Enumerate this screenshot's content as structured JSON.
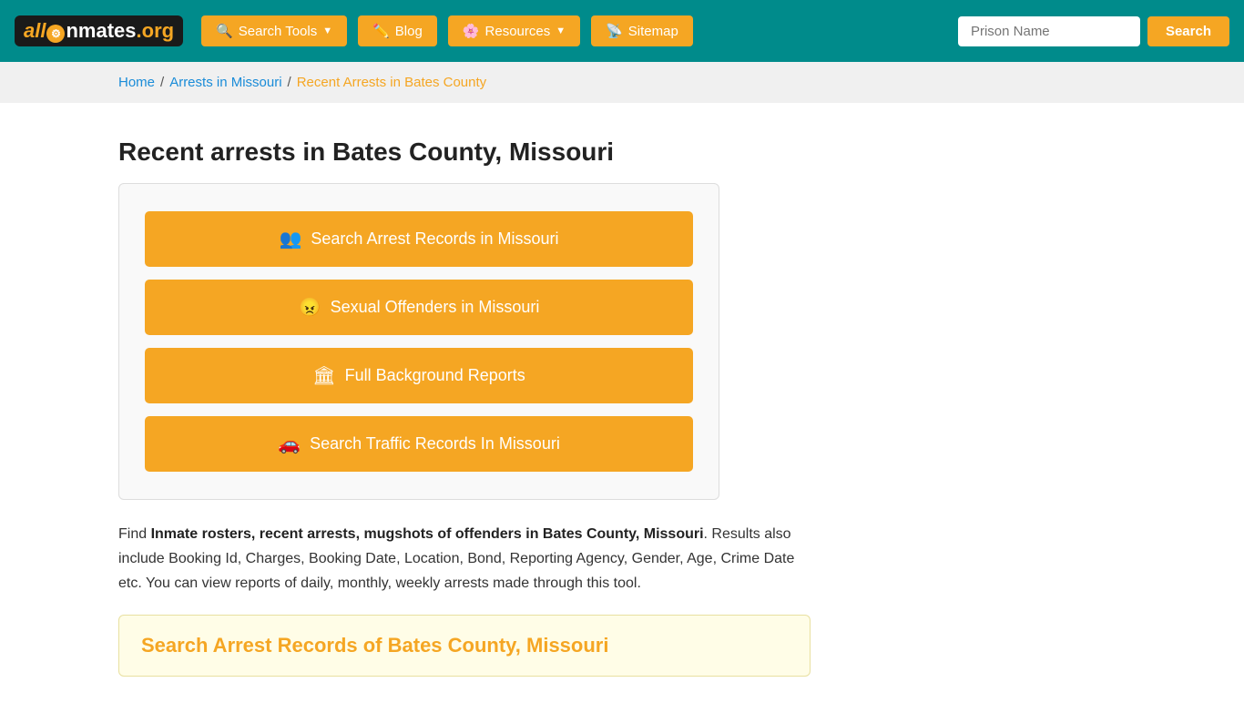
{
  "header": {
    "logo": {
      "text_all": "all",
      "text_inmates": "Inmates",
      "text_org": ".org"
    },
    "nav": [
      {
        "id": "search-tools",
        "label": "Search Tools",
        "has_dropdown": true,
        "icon": "🔍"
      },
      {
        "id": "blog",
        "label": "Blog",
        "has_dropdown": false,
        "icon": "✏️"
      },
      {
        "id": "resources",
        "label": "Resources",
        "has_dropdown": true,
        "icon": "🌸"
      },
      {
        "id": "sitemap",
        "label": "Sitemap",
        "has_dropdown": false,
        "icon": "📡"
      }
    ],
    "search_input_placeholder": "Prison Name",
    "search_button_label": "Search"
  },
  "breadcrumb": {
    "home": "Home",
    "arrests": "Arrests in Missouri",
    "current": "Recent Arrests in Bates County"
  },
  "page": {
    "title": "Recent arrests in Bates County, Missouri",
    "action_buttons": [
      {
        "id": "arrest-records",
        "icon": "👥",
        "label": "Search Arrest Records in Missouri"
      },
      {
        "id": "sexual-offenders",
        "icon": "😠",
        "label": "Sexual Offenders in Missouri"
      },
      {
        "id": "background-reports",
        "icon": "🏛",
        "label": "Full Background Reports"
      },
      {
        "id": "traffic-records",
        "icon": "🚗",
        "label": "Search Traffic Records In Missouri"
      }
    ],
    "description_prefix": "Find ",
    "description_bold": "Inmate rosters, recent arrests, mugshots of offenders in Bates County, Missouri",
    "description_suffix": ". Results also include Booking Id, Charges, Booking Date, Location, Bond, Reporting Agency, Gender, Age, Crime Date etc. You can view reports of daily, monthly, weekly arrests made through this tool.",
    "search_records_title": "Search Arrest Records of Bates County, Missouri"
  }
}
